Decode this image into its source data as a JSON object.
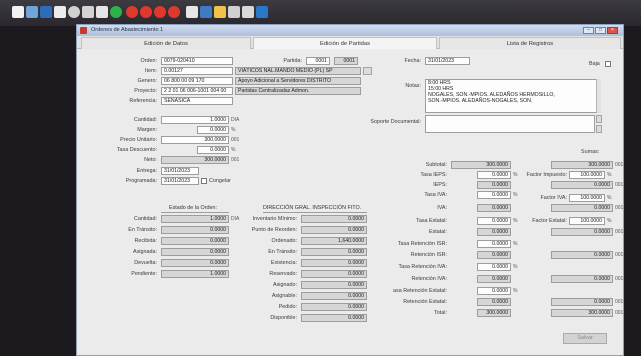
{
  "toolbar": {
    "icons": [
      {
        "name": "new-icon",
        "color": "#f2f2f2"
      },
      {
        "name": "copy-icon",
        "color": "#6fa6d9"
      },
      {
        "name": "save-icon",
        "color": "#2b6db8"
      },
      {
        "name": "close-icon",
        "color": "#ececec"
      },
      {
        "name": "print-preview-icon",
        "color": "#d1d1d1"
      },
      {
        "name": "search-icon",
        "color": "#d3d3d3"
      },
      {
        "name": "grid-icon",
        "color": "#e5e5e5"
      },
      {
        "name": "refresh-icon",
        "color": "#2bb24c"
      },
      {
        "name": "first-icon",
        "color": "#e0382b"
      },
      {
        "name": "prev-icon",
        "color": "#e0382b"
      },
      {
        "name": "next-icon",
        "color": "#e0382b"
      },
      {
        "name": "last-icon",
        "color": "#e0382b"
      },
      {
        "name": "binoculars-icon",
        "color": "#e6e6e6"
      },
      {
        "name": "printer-icon",
        "color": "#3f7ac5"
      },
      {
        "name": "export-icon",
        "color": "#f0c24a"
      },
      {
        "name": "layout-icon",
        "color": "#d0d0d0"
      },
      {
        "name": "cloud-icon",
        "color": "#d9d9d9"
      },
      {
        "name": "apps-icon",
        "color": "#2a78c8"
      }
    ]
  },
  "window": {
    "title": "Ordenes de Abastecimiento 1",
    "controls": {
      "minimize": "–",
      "maximize": "□",
      "close": "×"
    }
  },
  "tabs": [
    {
      "label": "Edición de Datos"
    },
    {
      "label": "Edición de Partidas"
    },
    {
      "label": "Lista de Registros"
    }
  ],
  "header": {
    "orden_label": "Orden:",
    "orden_value": "0079-020410",
    "item_label": "Item:",
    "item_value": "0.00127",
    "item_desc": "VIÁTICOS NAL.MANDO MEDIO (PL) SP",
    "genero_label": "Genero:",
    "genero_value": "06 800 00 09 170",
    "genero_desc": "Apoyo Adicional a Servidores DISTRITO",
    "proyecto_label": "Proyecto:",
    "proyecto_value": "2 2 01 06 006-1001 004 00",
    "proyecto_desc": "Partidas Centralizadas Admon.",
    "referencia_label": "Referencia:",
    "referencia_value": "SENASICA",
    "partida_label": "Partida:",
    "partida_value": "0001",
    "partida_value2": "0001",
    "fecha_label": "Fecha:",
    "fecha_value": "31/01/2023",
    "baja_label": "Baja"
  },
  "notas": {
    "label": "Notas:",
    "lines": [
      "8:00 HRS",
      "15:00 HRS",
      "NOGALES, SON.-MPIOS. ALEDAÑOS HERMOSILLO,",
      "SON.-MPIOS. ALEDAÑOS-NOGALES, SON."
    ]
  },
  "soporte": {
    "label": "Soporte Documental:"
  },
  "pricing": {
    "cantidad_label": "Cantidad:",
    "cantidad": "1.0000",
    "cantidad_unit": "DIA",
    "margen_label": "Margen:",
    "margen": "0.0000",
    "margen_unit": "%",
    "precio_label": "Precio Unitario:",
    "precio": "300.0000",
    "precio_unit": "001",
    "tasa_desc_label": "Tasa Descuento:",
    "tasa_desc": "0.0000",
    "tasa_desc_unit": "%",
    "neto_label": "Neto:",
    "neto": "300.0000",
    "neto_unit": "001",
    "entrega_label": "Entrega:",
    "entrega": "31/01/2023",
    "programada_label": "Programada:",
    "programada": "31/01/2023",
    "congelar_label": "Congelar"
  },
  "totals": {
    "sumas_label": "Sumas:",
    "subtotal_label": "Subtotal:",
    "subtotal": "300.0000",
    "subtotal_sum": "300.0000",
    "subtotal_unit": "001",
    "tasa_ieps_label": "Tasa IEPS:",
    "tasa_ieps": "0.0000",
    "tasa_ieps_unit": "%",
    "factor_impuesto_label": "Factor Impuesto:",
    "factor_impuesto": "100.0000",
    "factor_impuesto_unit": "%",
    "ieps_label": "IEPS:",
    "ieps": "0.0000",
    "ieps_sum": "0.0000",
    "ieps_unit": "001",
    "tasa_iva_label": "Tasa IVA:",
    "tasa_iva": "0.0000",
    "tasa_iva_unit": "%",
    "factor_iva_label": "Factor IVA:",
    "factor_iva": "100.0000",
    "factor_iva_unit": "%",
    "iva_label": "IVA:",
    "iva": "0.0000",
    "iva_sum": "0.0000",
    "iva_unit": "001",
    "tasa_estatal_label": "Tasa Estatal:",
    "tasa_estatal": "0.0000",
    "tasa_estatal_unit": "%",
    "factor_estatal_label": "Factor Estatal:",
    "factor_estatal": "100.0000",
    "factor_estatal_unit": "%",
    "estatal_label": "Estatal:",
    "estatal": "0.0000",
    "estatal_sum": "0.0000",
    "estatal_unit": "001",
    "tasa_ret_isr_label": "Tasa Retención ISR:",
    "tasa_ret_isr": "0.0000",
    "tasa_ret_isr_unit": "%",
    "ret_isr_label": "Retención ISR:",
    "ret_isr": "0.0000",
    "ret_isr_sum": "0.0000",
    "ret_isr_unit": "001",
    "tasa_ret_iva_label": "Tasa Retención IVA:",
    "tasa_ret_iva": "0.0000",
    "tasa_ret_iva_unit": "%",
    "ret_iva_label": "Retención IVA:",
    "ret_iva": "0.0000",
    "ret_iva_sum": "0.0000",
    "ret_iva_unit": "001",
    "tasa_ret_est_label": "asa Retención Estatal:",
    "tasa_ret_est": "0.0000",
    "tasa_ret_est_unit": "%",
    "ret_est_label": "Retención Estatal:",
    "ret_est": "0.0000",
    "ret_est_sum": "0.0000",
    "ret_est_unit": "001",
    "total_label": "Total:",
    "total": "300.0000",
    "total_sum": "300.0000",
    "total_unit": "001"
  },
  "estado": {
    "title": "Estado de la Orden:",
    "rows": [
      {
        "label": "Cantidad:",
        "value": "1.0000",
        "unit": "DIA"
      },
      {
        "label": "En Tránsito:",
        "value": "0.0000"
      },
      {
        "label": "Recibida:",
        "value": "0.0000"
      },
      {
        "label": "Asignada:",
        "value": "0.0000"
      },
      {
        "label": "Devuelta:",
        "value": "0.0000"
      },
      {
        "label": "Pendiente:",
        "value": "1.0000"
      }
    ]
  },
  "inventario": {
    "title": "DIRECCIÓN GRAL. INSPECCIÓN FITO.",
    "rows": [
      {
        "label": "Inventario Mínimo:",
        "value": "0.0000"
      },
      {
        "label": "Punto de Reorden:",
        "value": "0.0000"
      },
      {
        "label": "Ordenado:",
        "value": "1,640.0000"
      },
      {
        "label": "En Tránsito:",
        "value": "0.0000"
      },
      {
        "label": "Existencia:",
        "value": "0.0000"
      },
      {
        "label": "Reservado:",
        "value": "0.0000"
      },
      {
        "label": "Asignado:",
        "value": "0.0000"
      },
      {
        "label": "Asignable:",
        "value": "0.0000"
      },
      {
        "label": "Pedido:",
        "value": "0.0000"
      },
      {
        "label": "Disponible:",
        "value": "0.0000"
      }
    ]
  },
  "actions": {
    "save_label": "Salvar"
  }
}
